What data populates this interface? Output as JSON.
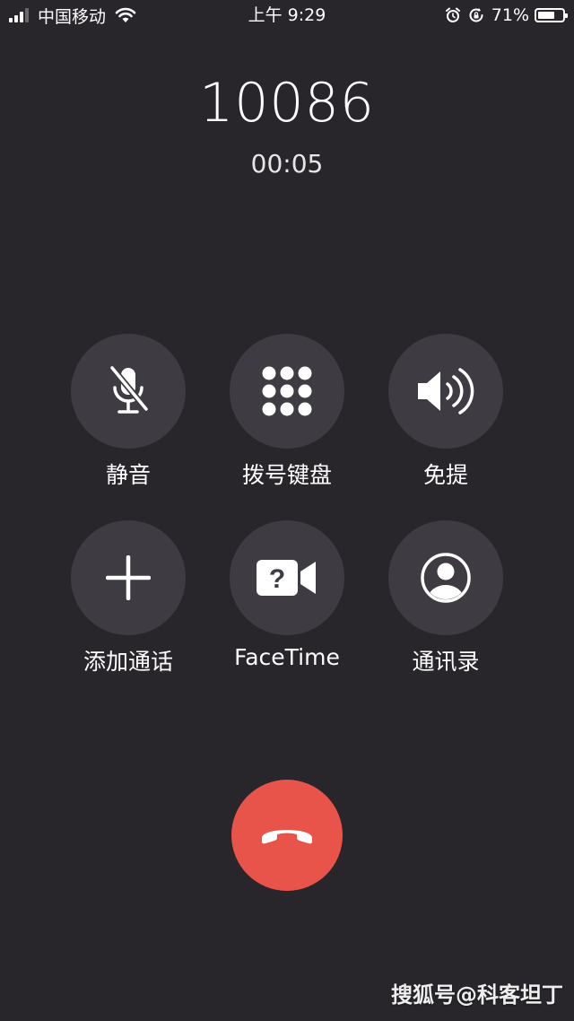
{
  "status_bar": {
    "carrier": "中国移动",
    "time": "上午 9:29",
    "battery_percent": "71%",
    "battery_level": 0.71,
    "icons": [
      "signal-icon",
      "wifi-icon",
      "alarm-icon",
      "orientation-lock-icon",
      "battery-icon"
    ]
  },
  "call": {
    "number": "10086",
    "duration": "00:05"
  },
  "controls": [
    {
      "label": "静音",
      "icon": "mic-off-icon"
    },
    {
      "label": "拨号键盘",
      "icon": "keypad-icon"
    },
    {
      "label": "免提",
      "icon": "speaker-icon"
    },
    {
      "label": "添加通话",
      "icon": "plus-icon"
    },
    {
      "label": "FaceTime",
      "icon": "facetime-unavailable-icon"
    },
    {
      "label": "通讯录",
      "icon": "contacts-icon"
    }
  ],
  "end_call": {
    "icon": "end-call-icon",
    "color": "#e8544a"
  },
  "watermark": "搜狐号@科客坦丁",
  "colors": {
    "background": "#28262b",
    "button": "#3e3c42",
    "end_call": "#e8544a"
  }
}
